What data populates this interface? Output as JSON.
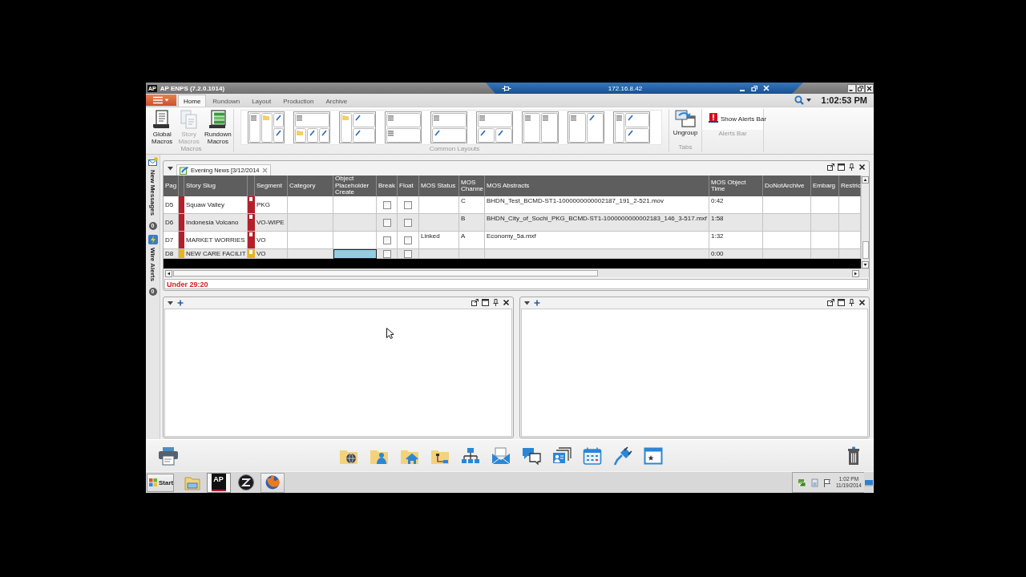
{
  "title_bar": {
    "logo": "AP",
    "title": "AP ENPS (7.2.0.1014)",
    "remote_host": "172.16.8.42"
  },
  "ribbon": {
    "tabs": [
      {
        "label": "Home",
        "selected": true
      },
      {
        "label": "Rundown",
        "selected": false
      },
      {
        "label": "Layout",
        "selected": false
      },
      {
        "label": "Production",
        "selected": false
      },
      {
        "label": "Archive",
        "selected": false
      }
    ],
    "clock": "1:02:53 PM",
    "groups": [
      {
        "kind": "macros",
        "label": "Macros",
        "buttons": [
          {
            "label": "Global Macros",
            "disabled": false
          },
          {
            "label": "Story Macros",
            "disabled": true
          },
          {
            "label": "Rundown Macros",
            "disabled": false
          }
        ]
      },
      {
        "kind": "layouts",
        "label": "Common Layouts"
      },
      {
        "kind": "tabs",
        "label": "Tabs",
        "buttons": [
          {
            "label": "Ungroup",
            "disabled": false
          }
        ]
      },
      {
        "kind": "alerts",
        "label": "Alerts Bar",
        "buttons": [
          {
            "label": "Show Alerts Bar",
            "disabled": false
          }
        ]
      }
    ]
  },
  "side_bar": [
    {
      "label": "New Messages",
      "count": "0"
    },
    {
      "label": "Wire Alerts",
      "count": "0"
    }
  ],
  "rundown": {
    "tab": "Evening News [3/12/2014",
    "columns": [
      "Pag",
      "Story Slug",
      "Segment",
      "Category",
      "Object Placeholder Create",
      "Break",
      "Float",
      "MOS Status",
      "MOS Channe",
      "MOS Abstracts",
      "MOS Object Time",
      "DoNotArchive",
      "Embarg",
      "Restric"
    ],
    "rows": [
      {
        "page": "D5",
        "color": "#b3202a",
        "slug": "Squaw Valley",
        "segment": "PKG",
        "placeholder_selected": false,
        "break_checked": false,
        "float_checked": false,
        "mos_channel": "C",
        "mos_abstract": "BHDN_Test_BCMD-ST1-1000000000002187_191_2-521.mov",
        "mos_time": "0:42"
      },
      {
        "page": "D6",
        "color": "#b3202a",
        "slug": "Indonesia Volcano",
        "segment": "VO-WIPE",
        "placeholder_selected": false,
        "break_checked": false,
        "float_checked": false,
        "mos_channel": "B",
        "mos_abstract": "BHDN_City_of_Sochi_PKG_BCMD-ST1-1000000000002183_146_3-517.mxf",
        "mos_time": "1:58"
      },
      {
        "page": "D7",
        "color": "#b3202a",
        "slug": "MARKET WORRIES",
        "segment": "VO",
        "placeholder_selected": false,
        "break_checked": false,
        "float_checked": false,
        "mos_status": "Linked",
        "mos_channel": "A",
        "mos_abstract": "Economy_5a.mxf",
        "mos_time": "1:32"
      },
      {
        "page": "D8",
        "color": "#e6b422",
        "slug": "NEW CARE FACILIT",
        "segment": "VO",
        "placeholder_selected": true,
        "break_checked": false,
        "float_checked": false,
        "mos_time": "0:00"
      }
    ],
    "status": "Under 29:20"
  },
  "taskbar": {
    "start": "Start",
    "app_badge": "AP",
    "tray_time": "1:02 PM",
    "tray_date": "11/19/2014"
  }
}
